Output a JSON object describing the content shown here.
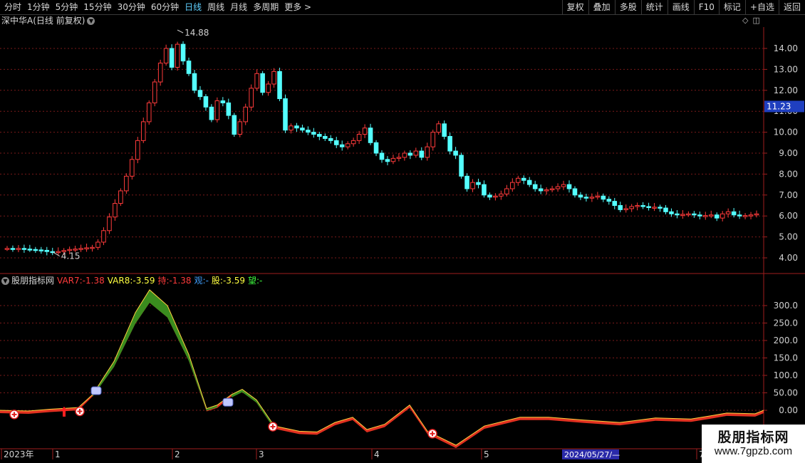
{
  "toolbar": {
    "period_tabs": [
      "分时",
      "1分钟",
      "5分钟",
      "15分钟",
      "30分钟",
      "60分钟",
      "日线",
      "周线",
      "月线",
      "多周期",
      "更多 >"
    ],
    "active_tab": "日线",
    "right_buttons": [
      "复权",
      "叠加",
      "多股",
      "统计",
      "画线",
      "F10",
      "标记",
      "+自选",
      "返回"
    ]
  },
  "main_chart": {
    "title": "深中华A(日线 前复权)",
    "price_ticks": [
      "14.00",
      "13.00",
      "12.00",
      "11.00",
      "10.00",
      "9.00",
      "8.00",
      "7.00",
      "6.00",
      "5.00",
      "4.00"
    ],
    "current_price_label": "11.23",
    "high_label": "14.88",
    "low_label": "4.15"
  },
  "indicator": {
    "name": "股朋指标网",
    "values": [
      {
        "label": "VAR7:",
        "value": "-1.38",
        "color": "#ff3b3b"
      },
      {
        "label": "VAR8:",
        "value": "-3.59",
        "color": "#ffff40"
      },
      {
        "label": "持:",
        "value": "-1.38",
        "color": "#ff3b3b"
      },
      {
        "label": "观:",
        "value": "-",
        "color": "#40a0ff"
      },
      {
        "label": "股:",
        "value": "-3.59",
        "color": "#ffff40"
      },
      {
        "label": "望:",
        "value": "-",
        "color": "#40ff40"
      }
    ],
    "ticks": [
      "300.0",
      "250.0",
      "200.0",
      "150.0",
      "100.0",
      "50.00",
      "0.00"
    ]
  },
  "time_axis": {
    "labels": [
      "2023年",
      "1",
      "2",
      "3",
      "4",
      "5",
      "7"
    ],
    "cursor_date": "2024/05/27/—"
  },
  "watermark": {
    "title": "股朋指标网",
    "url": "www.7gpzb.com"
  },
  "colors": {
    "up": "#ff3b3b",
    "down": "#54ffff",
    "grid": "#7a1a1a",
    "axis": "#a01e1e"
  }
}
